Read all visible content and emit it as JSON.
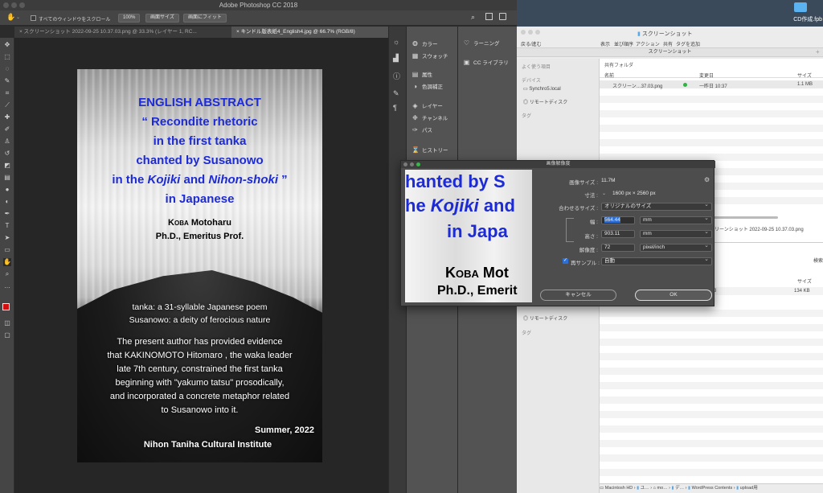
{
  "photoshop": {
    "app_title": "Adobe Photoshop CC 2018",
    "options": {
      "scroll_all_label": "すべてのウィンドウをスクロール",
      "zoom_label": "100%",
      "fit_screen_label": "画面サイズ",
      "fill_screen_label": "画面にフィット"
    },
    "tabs": [
      {
        "label": "スクリーンショット 2022-09-25 10.37.03.png @ 33.3% (レイヤー 1, RC..."
      },
      {
        "label": "キンドル版表紙4_English4.jpg @ 66.7% (RGB/8)"
      }
    ],
    "cover": {
      "heading": "ENGLISH ABSTRACT",
      "title_lines": [
        "“ Recondite rhetoric",
        "in the first tanka",
        "chanted by Susanowo"
      ],
      "title_line4_pre": "in the ",
      "title_line4_kojiki": "Kojiki",
      "title_line4_and": " and ",
      "title_line4_nihon": "Nihon-shoki",
      "title_line4_post": " ”",
      "title_line5": "in Japanese",
      "author_koba": "Koba",
      "author_name": " Motoharu",
      "author_degree": "Ph.D., Emeritus Prof.",
      "note1": "tanka: a 31-syllable Japanese poem",
      "note2": "Susanowo: a deity of ferocious nature",
      "abstract_lines": [
        "The present author has provided evidence",
        "that KAKINOMOTO Hitomaro , the waka leader",
        "late 7th century, constrained  the first tanka",
        "beginning with \"yakumo tatsu\" prosodically,",
        "and incorporated a concrete metaphor related",
        "to Susanowo into it."
      ],
      "date": "Summer, 2022",
      "institute": "Nihon Taniha Cultural Institute"
    },
    "panels": {
      "col1": [
        {
          "icon": "swatch-color-icon",
          "label": "カラー"
        },
        {
          "icon": "swatches-icon",
          "label": "スウォッチ"
        },
        {
          "icon": "properties-icon",
          "label": "属性"
        },
        {
          "icon": "adjustments-icon",
          "label": "色調補正"
        },
        {
          "icon": "layers-icon",
          "label": "レイヤー"
        },
        {
          "icon": "channels-icon",
          "label": "チャンネル"
        },
        {
          "icon": "paths-icon",
          "label": "パス"
        },
        {
          "icon": "history-icon",
          "label": "ヒストリー"
        }
      ],
      "col2": [
        {
          "icon": "learn-icon",
          "label": "ラーニング"
        },
        {
          "icon": "cc-libraries-icon",
          "label": "CC ライブラリ"
        }
      ]
    }
  },
  "finder": {
    "window_title": "スクリーンショット",
    "toolbar_labels": [
      "戻る/進む",
      "表示",
      "並び順序",
      "アクション",
      "共有",
      "タグを追加"
    ],
    "path_title": "スクリーンショット",
    "sidebar": {
      "favorites": "よく使う項目",
      "devices": "デバイス",
      "device_items": [
        "Synchro5.local",
        "リモートディスク"
      ],
      "tags": "タグ",
      "remote_disk_lower": "リモートディスク",
      "tags_lower": "タグ"
    },
    "shared_folder": "共有フォルダ",
    "columns": {
      "name": "名前",
      "modified": "変更日",
      "size": "サイズ"
    },
    "row": {
      "name": "スクリーン…37.03.png",
      "modified": "一昨日 10:37",
      "size": "1.1 MB"
    },
    "preview_filename": "リーンショット 2022-09-25 10.37.03.png",
    "second": {
      "search_label": "検索",
      "size_col": "サイズ",
      "row_num": "3",
      "row_size": "134 KB"
    },
    "breadcrumb": [
      "Macintosh HD",
      "ユ…",
      "mo…",
      "デ…",
      "WordPress Contents",
      "upload用"
    ],
    "desktop_file": "CD作成.fpb"
  },
  "dialog": {
    "title": "画像解像度",
    "image_size_label": "画像サイズ :",
    "image_size_value": "11.7M",
    "dimensions_label": "寸法 :",
    "dimensions_value": "1600 px × 2560 px",
    "fit_label": "合わせるサイズ :",
    "fit_value": "オリジナルのサイズ",
    "width_label": "幅 :",
    "width_value": "564.44",
    "width_unit": "mm",
    "height_label": "高さ :",
    "height_value": "903.11",
    "height_unit": "mm",
    "resolution_label": "解像度 :",
    "resolution_value": "72",
    "resolution_unit": "pixel/inch",
    "resample_label": "再サンプル :",
    "resample_value": "自動",
    "cancel_label": "キャンセル",
    "ok_label": "OK",
    "preview": {
      "line1": "hanted by S",
      "line2_pre": "he ",
      "line2_kojiki": "Kojiki",
      "line2_post": " and",
      "line3": "in Japa",
      "line4_koba": "Koba",
      "line4_name": " Mot",
      "line5": "Ph.D., Emerit"
    }
  }
}
